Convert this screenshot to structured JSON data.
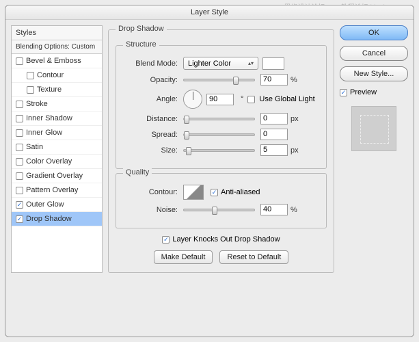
{
  "watermark": "思缘设计论坛…PS教程论坛 bbs.lexxx.com",
  "title": "Layer Style",
  "left": {
    "styles_header": "Styles",
    "blending_header": "Blending Options: Custom",
    "items": [
      {
        "label": "Bevel & Emboss",
        "checked": false,
        "indent": false
      },
      {
        "label": "Contour",
        "checked": false,
        "indent": true
      },
      {
        "label": "Texture",
        "checked": false,
        "indent": true
      },
      {
        "label": "Stroke",
        "checked": false,
        "indent": false
      },
      {
        "label": "Inner Shadow",
        "checked": false,
        "indent": false
      },
      {
        "label": "Inner Glow",
        "checked": false,
        "indent": false
      },
      {
        "label": "Satin",
        "checked": false,
        "indent": false
      },
      {
        "label": "Color Overlay",
        "checked": false,
        "indent": false
      },
      {
        "label": "Gradient Overlay",
        "checked": false,
        "indent": false
      },
      {
        "label": "Pattern Overlay",
        "checked": false,
        "indent": false
      },
      {
        "label": "Outer Glow",
        "checked": true,
        "indent": false
      },
      {
        "label": "Drop Shadow",
        "checked": true,
        "indent": false,
        "selected": true
      }
    ]
  },
  "main": {
    "panel_title": "Drop Shadow",
    "structure_label": "Structure",
    "quality_label": "Quality",
    "blend_mode_label": "Blend Mode:",
    "blend_mode_value": "Lighter Color",
    "opacity_label": "Opacity:",
    "opacity_value": "70",
    "opacity_unit": "%",
    "angle_label": "Angle:",
    "angle_value": "90",
    "angle_unit": "°",
    "global_light_label": "Use Global Light",
    "global_light_checked": false,
    "distance_label": "Distance:",
    "distance_value": "0",
    "spread_label": "Spread:",
    "spread_value": "0",
    "size_label": "Size:",
    "size_value": "5",
    "px_unit": "px",
    "contour_label": "Contour:",
    "anti_aliased_label": "Anti-aliased",
    "anti_aliased_checked": true,
    "noise_label": "Noise:",
    "noise_value": "40",
    "noise_unit": "%",
    "knockout_label": "Layer Knocks Out Drop Shadow",
    "knockout_checked": true,
    "make_default": "Make Default",
    "reset_default": "Reset to Default"
  },
  "right": {
    "ok": "OK",
    "cancel": "Cancel",
    "new_style": "New Style...",
    "preview_label": "Preview",
    "preview_checked": true
  }
}
